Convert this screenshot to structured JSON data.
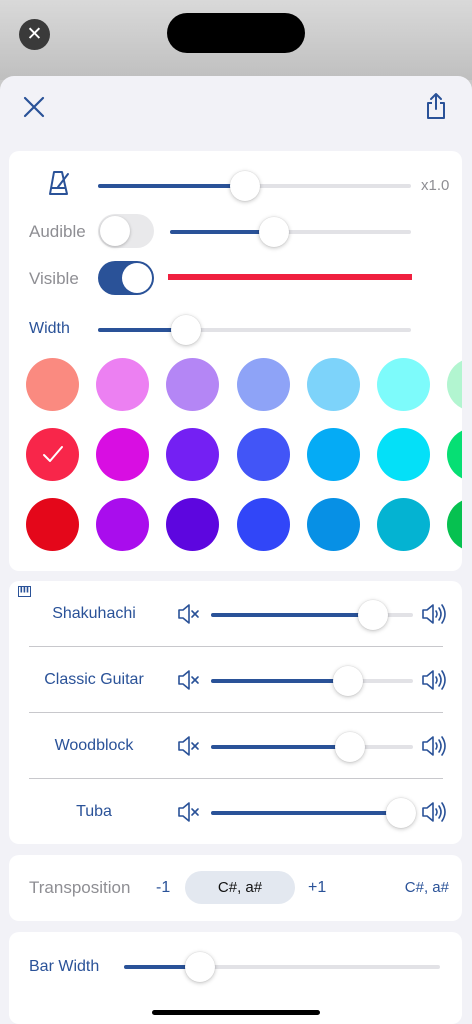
{
  "header": {
    "close_icon": "xmark",
    "share_icon": "square-and-arrow-up"
  },
  "visual": {
    "speed_label": "x1.0",
    "audible_label": "Audible",
    "visible_label": "Visible",
    "width_label": "Width",
    "audible_on": false,
    "visible_on": true,
    "speed_level": 0.47,
    "audible_volume": 0.43,
    "width_level": 0.28,
    "highlight_color": "#f0203f",
    "accent_color": "#2a5298"
  },
  "palette": {
    "rows": [
      [
        "#fa8a80",
        "#ec80f2",
        "#b486f5",
        "#8ea3f7",
        "#7dd3fa",
        "#7dfbfb",
        "#b2f5d0"
      ],
      [
        "#f8264a",
        "#d80ee2",
        "#7420f3",
        "#4255f7",
        "#05abf5",
        "#04e0f8",
        "#06df74"
      ],
      [
        "#e4071a",
        "#a90ded",
        "#5d06df",
        "#3146f8",
        "#0790e5",
        "#04b3d2",
        "#06c150"
      ]
    ],
    "selected": "1-0"
  },
  "instruments": [
    {
      "name": "Shakuhachi",
      "volume": 0.8
    },
    {
      "name": "Classic Guitar",
      "volume": 0.68
    },
    {
      "name": "Woodblock",
      "volume": 0.69
    },
    {
      "name": "Tuba",
      "volume": 0.94
    }
  ],
  "transposition": {
    "label": "Transposition",
    "minus": "-1",
    "current": "C#, a#",
    "plus": "+1",
    "result": "C#, a#"
  },
  "bar_width": {
    "label": "Bar Width",
    "level": 0.24
  }
}
